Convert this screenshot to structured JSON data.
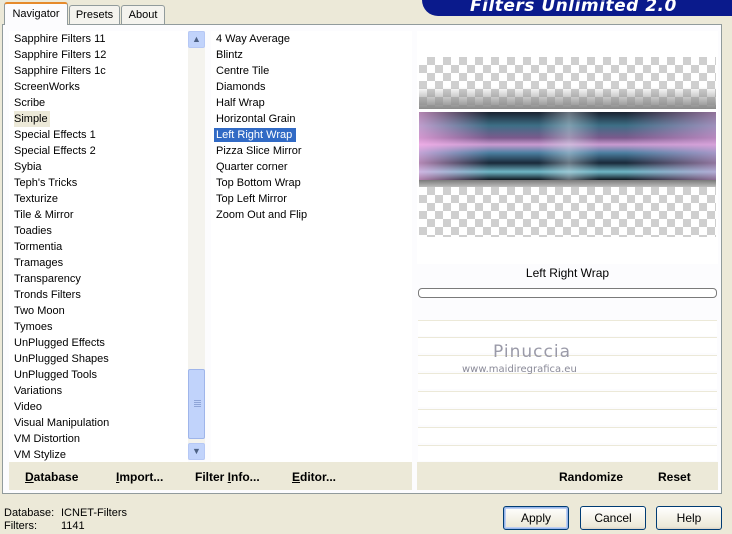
{
  "banner": {
    "title": "Filters Unlimited 2.0"
  },
  "tabs": [
    {
      "label": "Navigator",
      "active": true
    },
    {
      "label": "Presets",
      "active": false
    },
    {
      "label": "About",
      "active": false
    }
  ],
  "categories": {
    "items": [
      "Sapphire Filters 11",
      "Sapphire Filters 12",
      "Sapphire Filters 1c",
      "ScreenWorks",
      "Scribe",
      "Simple",
      "Special Effects 1",
      "Special Effects 2",
      "Sybia",
      "Teph's Tricks",
      "Texturize",
      "Tile & Mirror",
      "Toadies",
      "Tormentia",
      "Tramages",
      "Transparency",
      "Tronds Filters",
      "Two Moon",
      "Tymoes",
      "UnPlugged Effects",
      "UnPlugged Shapes",
      "UnPlugged Tools",
      "Variations",
      "Video",
      "Visual Manipulation",
      "VM Distortion",
      "VM Stylize"
    ],
    "selected": "Simple"
  },
  "filters": {
    "items": [
      "4 Way Average",
      "Blintz",
      "Centre Tile",
      "Diamonds",
      "Half Wrap",
      "Horizontal Grain",
      "Left Right Wrap",
      "Pizza Slice Mirror",
      "Quarter corner",
      "Top Bottom Wrap",
      "Top Left Mirror",
      "Zoom Out and Flip"
    ],
    "selected": "Left Right Wrap"
  },
  "left_buttons": {
    "database": "Database",
    "import": "Import...",
    "filter_info": "Filter Info...",
    "editor": "Editor..."
  },
  "preview": {
    "filter_name": "Left Right Wrap",
    "watermark_name": "Pinuccia",
    "watermark_url": "www.maidiregrafica.eu"
  },
  "right_buttons": {
    "randomize": "Randomize",
    "reset": "Reset"
  },
  "footer": {
    "database_label": "Database:",
    "database_value": "ICNET-Filters",
    "filters_label": "Filters:",
    "filters_value": "1141"
  },
  "dialog_buttons": {
    "apply": "Apply",
    "cancel": "Cancel",
    "help": "Help"
  },
  "icons": {
    "scroll_up": "chevron-up-icon",
    "scroll_down": "chevron-down-icon"
  }
}
